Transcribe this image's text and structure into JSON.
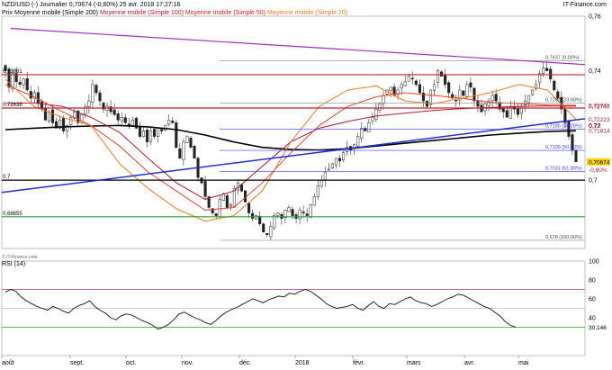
{
  "header": {
    "symbol": "NZD/USD (-)",
    "period": "Journalier",
    "last": "0,70674",
    "change": "(-0,60%)",
    "timestamp": "25 avr. 2018 17:27:16",
    "source": "IT-Finance.com"
  },
  "legend": [
    {
      "label": "Prix Moyenne mobile (Simple 200)",
      "color": "#000000"
    },
    {
      "label": "Moyenne mobile (Simple 100)",
      "color": "#b2182b"
    },
    {
      "label": "Moyenne mobile (Simple 50)",
      "color": "#e31a1c"
    },
    {
      "label": "Moyenne mobile (Simple 20)",
      "color": "#f47a20"
    }
  ],
  "rsi_label": "RSI (14)",
  "watermark": "© IT-Finance.com",
  "colors": {
    "sma200": "#000000",
    "sma100": "#b2182b",
    "sma50": "#e8432a",
    "sma20": "#f47a20",
    "trend_blue": "#1f2fd6",
    "trend_purple": "#9b30c8",
    "support_green": "#2ca02c",
    "resistance": "#c0262c",
    "fib_blue": "#3b3bff"
  },
  "chart_data": [
    {
      "type": "candlestick",
      "title": "NZD/USD",
      "x_labels": [
        "août",
        "sept.",
        "oct.",
        "nov.",
        "déc.",
        "2018",
        "févr.",
        "mars",
        "avr.",
        "mai"
      ],
      "ylim": [
        0.675,
        0.76
      ],
      "y_ticks": [
        "0,76",
        "0,74",
        "0,72",
        "0,7"
      ],
      "last_price": "0,70674",
      "last_change": "-0,60%",
      "levels": [
        {
          "label": "0,73861",
          "value": 0.7386,
          "color": "#c0262c"
        },
        {
          "label": "0,72638",
          "value": 0.7264,
          "color": "#c0262c"
        },
        {
          "label": "0,7",
          "value": 0.7,
          "color": "#000000"
        },
        {
          "label": "0,68655",
          "value": 0.6866,
          "color": "#2ca02c"
        }
      ],
      "right_labels": [
        {
          "label": "0,72741",
          "value": 0.7274
        },
        {
          "label": "0,72707",
          "value": 0.7271
        },
        {
          "label": "0,72223",
          "value": 0.7222
        },
        {
          "label": "0,72",
          "value": 0.72
        },
        {
          "label": "0,71814",
          "value": 0.7181
        }
      ],
      "fibonacci": [
        {
          "label": "0,7437 (0,00%)",
          "value": 0.7437
        },
        {
          "label": "0,7282 (23,60%)",
          "value": 0.7282
        },
        {
          "label": "0,7186 (38,20%)",
          "value": 0.7186
        },
        {
          "label": "0,7109 (50,00%)",
          "value": 0.7109
        },
        {
          "label": "0,7031 (61,80%)",
          "value": 0.7031
        },
        {
          "label": "0,678 (100,00%)",
          "value": 0.678
        }
      ],
      "close_series": [
        0.74,
        0.734,
        0.739,
        0.736,
        0.735,
        0.737,
        0.733,
        0.73,
        0.732,
        0.728,
        0.726,
        0.722,
        0.725,
        0.721,
        0.719,
        0.722,
        0.718,
        0.72,
        0.723,
        0.725,
        0.721,
        0.724,
        0.727,
        0.729,
        0.735,
        0.732,
        0.729,
        0.726,
        0.727,
        0.725,
        0.724,
        0.722,
        0.723,
        0.721,
        0.72,
        0.722,
        0.719,
        0.716,
        0.718,
        0.714,
        0.718,
        0.716,
        0.719,
        0.718,
        0.72,
        0.722,
        0.721,
        0.712,
        0.708,
        0.714,
        0.716,
        0.712,
        0.708,
        0.701,
        0.699,
        0.694,
        0.69,
        0.688,
        0.687,
        0.693,
        0.695,
        0.69,
        0.691,
        0.697,
        0.699,
        0.696,
        0.692,
        0.688,
        0.686,
        0.687,
        0.684,
        0.681,
        0.68,
        0.683,
        0.687,
        0.688,
        0.686,
        0.689,
        0.69,
        0.687,
        0.686,
        0.689,
        0.688,
        0.687,
        0.691,
        0.694,
        0.698,
        0.7,
        0.703,
        0.704,
        0.706,
        0.708,
        0.707,
        0.71,
        0.712,
        0.711,
        0.713,
        0.716,
        0.719,
        0.718,
        0.721,
        0.723,
        0.726,
        0.728,
        0.731,
        0.733,
        0.734,
        0.731,
        0.733,
        0.735,
        0.736,
        0.738,
        0.737,
        0.735,
        0.732,
        0.729,
        0.727,
        0.733,
        0.735,
        0.74,
        0.738,
        0.735,
        0.732,
        0.73,
        0.729,
        0.733,
        0.731,
        0.735,
        0.734,
        0.729,
        0.727,
        0.725,
        0.728,
        0.729,
        0.731,
        0.729,
        0.726,
        0.725,
        0.723,
        0.727,
        0.726,
        0.724,
        0.727,
        0.729,
        0.731,
        0.733,
        0.735,
        0.739,
        0.741,
        0.74,
        0.737,
        0.733,
        0.73,
        0.726,
        0.721,
        0.716,
        0.7109,
        0.7067
      ],
      "sma200_series": [
        0.7185,
        0.719,
        0.7195,
        0.7198,
        0.72,
        0.7195,
        0.7185,
        0.7165,
        0.714,
        0.712,
        0.7112,
        0.711,
        0.7115,
        0.7125,
        0.7135,
        0.7145,
        0.7155,
        0.7165,
        0.7172,
        0.7178,
        0.7181
      ],
      "sma100_series": [
        0.728,
        0.7283,
        0.727,
        0.723,
        0.7175,
        0.708,
        0.699,
        0.693,
        0.696,
        0.705,
        0.714,
        0.719,
        0.7215,
        0.7235,
        0.7245,
        0.7255,
        0.7262,
        0.7266,
        0.727,
        0.7272,
        0.7271
      ],
      "sma50_series": [
        0.735,
        0.7305,
        0.725,
        0.72,
        0.7125,
        0.703,
        0.696,
        0.689,
        0.69,
        0.699,
        0.71,
        0.72,
        0.727,
        0.7305,
        0.732,
        0.731,
        0.73,
        0.7285,
        0.728,
        0.7275,
        0.7274
      ],
      "sma20_series": [
        0.737,
        0.727,
        0.723,
        0.72,
        0.706,
        0.697,
        0.6895,
        0.685,
        0.687,
        0.696,
        0.714,
        0.727,
        0.733,
        0.7345,
        0.729,
        0.728,
        0.73,
        0.732,
        0.735,
        0.733,
        0.7222
      ]
    },
    {
      "type": "line",
      "title": "RSI (14)",
      "ylim": [
        0,
        100
      ],
      "y_ticks": [
        "100",
        "80",
        "60",
        "40"
      ],
      "levels": [
        70,
        30
      ],
      "last_value": "30,146",
      "values": [
        67,
        70,
        68,
        62,
        58,
        55,
        52,
        50,
        48,
        52,
        50,
        47,
        45,
        50,
        53,
        55,
        58,
        52,
        48,
        45,
        40,
        38,
        42,
        44,
        43,
        40,
        37,
        35,
        32,
        28,
        30,
        33,
        38,
        44,
        46,
        43,
        40,
        38,
        35,
        33,
        37,
        42,
        46,
        49,
        51,
        54,
        57,
        60,
        58,
        56,
        59,
        61,
        63,
        62,
        66,
        65,
        68,
        70,
        68,
        64,
        60,
        55,
        52,
        50,
        51,
        52,
        54,
        50,
        48,
        53,
        57,
        52,
        50,
        55,
        54,
        57,
        60,
        62,
        58,
        56,
        55,
        52,
        54,
        57,
        60,
        62,
        65,
        64,
        61,
        58,
        55,
        52,
        50,
        46,
        42,
        36,
        32,
        30.146
      ]
    }
  ]
}
